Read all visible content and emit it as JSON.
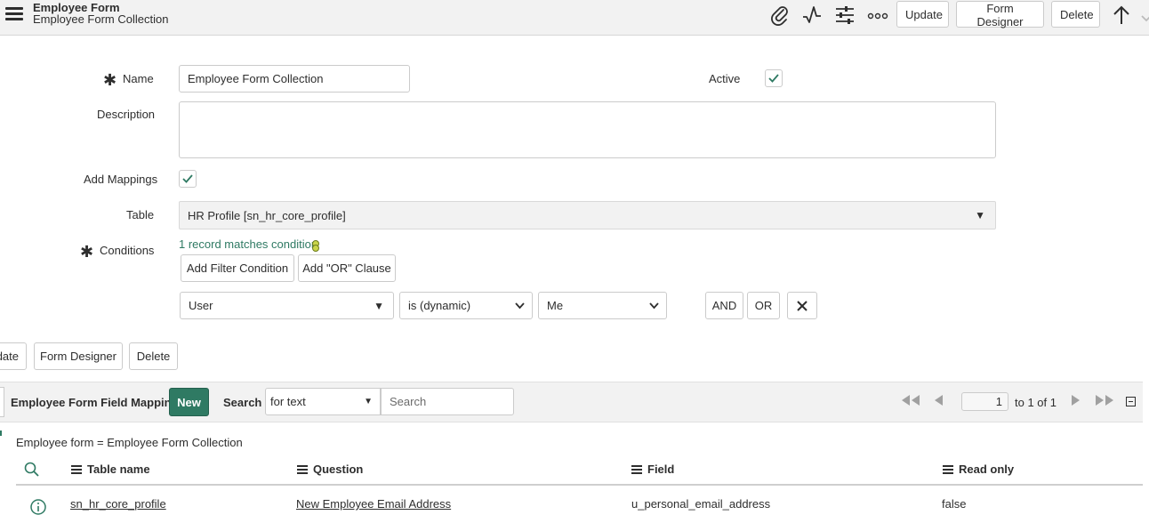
{
  "header": {
    "title": "Employee Form",
    "subtitle": "Employee Form Collection",
    "icons": [
      "paperclip-icon",
      "activity-icon",
      "sliders-icon",
      "more-icon",
      "arrow-up-icon"
    ],
    "update_label": "Update",
    "form_designer_label": "Form Designer",
    "delete_label": "Delete"
  },
  "form": {
    "name_label": "Name",
    "name_value": "Employee Form Collection",
    "active_label": "Active",
    "active_checked": true,
    "description_label": "Description",
    "description_value": "",
    "add_mappings_label": "Add Mappings",
    "add_mappings_checked": true,
    "table_label": "Table",
    "table_value": "HR Profile [sn_hr_core_profile]",
    "conditions_label": "Conditions",
    "record_match_text": "1 record matches condition",
    "add_filter_label": "Add Filter Condition",
    "add_or_label": "Add \"OR\" Clause",
    "condition": {
      "field": "User",
      "operator": "is (dynamic)",
      "value": "Me"
    },
    "and_label": "AND",
    "or_label": "OR"
  },
  "footer_buttons": {
    "update_label": "date",
    "form_designer_label": "Form Designer",
    "delete_label": "Delete"
  },
  "related_list": {
    "title": "Employee Form Field Mappings",
    "new_label": "New",
    "search_label": "Search",
    "search_select": "for text",
    "search_placeholder": "Search",
    "page_input": "1",
    "page_range": "to 1 of 1",
    "breadcrumb": "Employee form = Employee Form Collection",
    "columns": [
      "Table name",
      "Question",
      "Field",
      "Read only"
    ],
    "rows": [
      {
        "table_name": "sn_hr_core_profile",
        "question": "New Employee Email Address",
        "field": "u_personal_email_address",
        "read_only": "false"
      }
    ]
  }
}
